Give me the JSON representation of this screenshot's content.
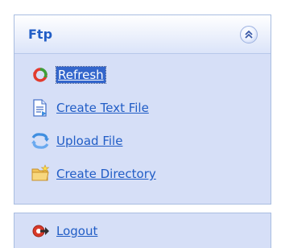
{
  "panel": {
    "title": "Ftp",
    "collapse_icon": "double-chevron-up-icon",
    "tasks": [
      {
        "label": "Refresh",
        "icon": "refresh-icon"
      },
      {
        "label": "Create Text File",
        "icon": "text-file-icon"
      },
      {
        "label": "Upload File",
        "icon": "upload-icon"
      },
      {
        "label": "Create Directory",
        "icon": "folder-icon"
      }
    ]
  },
  "panel2": {
    "logout_label": "Logout",
    "logout_icon": "logout-icon"
  }
}
